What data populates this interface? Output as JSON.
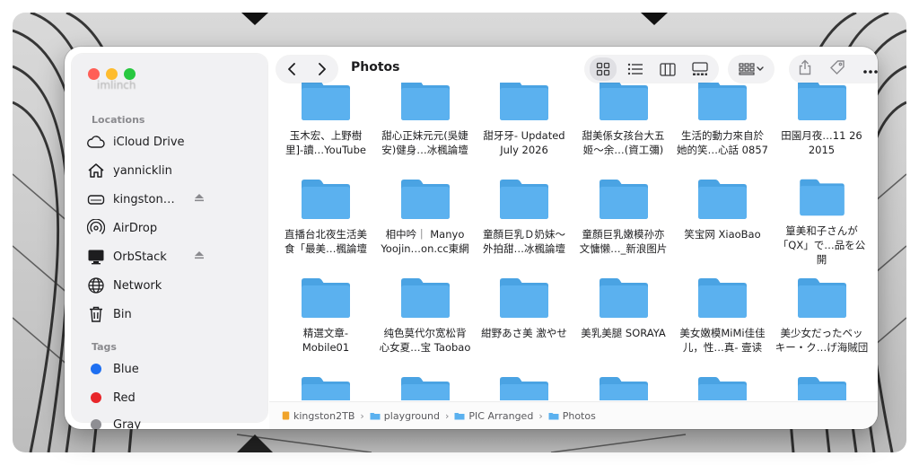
{
  "window": {
    "title": "Photos"
  },
  "sidebar": {
    "ghost_text": "imlinch",
    "locations_heading": "Locations",
    "locations": [
      {
        "label": "iCloud Drive",
        "icon": "cloud-icon"
      },
      {
        "label": "yannicklin",
        "icon": "home-icon"
      },
      {
        "label": "kingston…",
        "icon": "drive-icon",
        "ejectable": true
      },
      {
        "label": "AirDrop",
        "icon": "airdrop-icon"
      },
      {
        "label": "OrbStack",
        "icon": "display-icon",
        "ejectable": true
      },
      {
        "label": "Network",
        "icon": "globe-icon"
      },
      {
        "label": "Bin",
        "icon": "trash-icon"
      }
    ],
    "tags_heading": "Tags",
    "tags": [
      {
        "label": "Blue",
        "color": "#1e6ff1"
      },
      {
        "label": "Red",
        "color": "#e8262a"
      },
      {
        "label": "Gray",
        "color": "#8e8e93"
      }
    ]
  },
  "toolbar": {
    "views": [
      "icon-view",
      "list-view",
      "column-view",
      "gallery-view"
    ],
    "active_view": "icon-view"
  },
  "folders": [
    [
      "玉木宏、上野樹",
      "里]-讀…YouTube"
    ],
    [
      "甜心正妹元元(吳婕",
      "安)健身…冰楓論壇"
    ],
    [
      "甜牙牙- Updated",
      "July 2026"
    ],
    [
      "甜美係女孩台大五",
      "姬～余…(資工彌)"
    ],
    [
      "生活的動力來自於",
      "她的笑…心話 0857"
    ],
    [
      "田園月夜…11 26",
      "2015"
    ],
    [
      "直播台北夜生活美",
      "食「最美…楓論壇"
    ],
    [
      "相中吟｜ Manyo",
      "Yoojin…on.cc東網"
    ],
    [
      "童顏巨乳Ｄ奶妹～",
      "外拍甜…冰楓論壇"
    ],
    [
      "童顏巨乳嫩模孙亦",
      "文慵懒…_新浪图片"
    ],
    [
      "笑宝网 XiaoBao"
    ],
    [
      "篁美和子さんが",
      "「QX」で…品を公開"
    ],
    [
      "精選文章-",
      "Mobile01"
    ],
    [
      "纯色莫代尔宽松背",
      "心女夏…宝 Taobao"
    ],
    [
      "紺野あさ美 激やせ"
    ],
    [
      "美乳美腿 SORAYA"
    ],
    [
      "美女嫩模MiMi佳佳",
      "儿，性…真- 壹读"
    ],
    [
      "美少女だったベッ",
      "キー・ク…げ海賊団"
    ],
    [
      ""
    ],
    [
      ""
    ],
    [
      ""
    ],
    [
      ""
    ],
    [
      ""
    ],
    [
      ""
    ]
  ],
  "pathbar": [
    {
      "label": "kingston2TB",
      "icon": "drive-icon",
      "color": "#f0a32a"
    },
    {
      "label": "playground",
      "icon": "folder-icon",
      "color": "#5bb1ef"
    },
    {
      "label": "PIC Arranged",
      "icon": "folder-icon",
      "color": "#5bb1ef"
    },
    {
      "label": "Photos",
      "icon": "folder-icon",
      "color": "#5bb1ef"
    }
  ],
  "colors": {
    "folder": "#5bb1ef",
    "folder_tab": "#4aa3e3"
  }
}
